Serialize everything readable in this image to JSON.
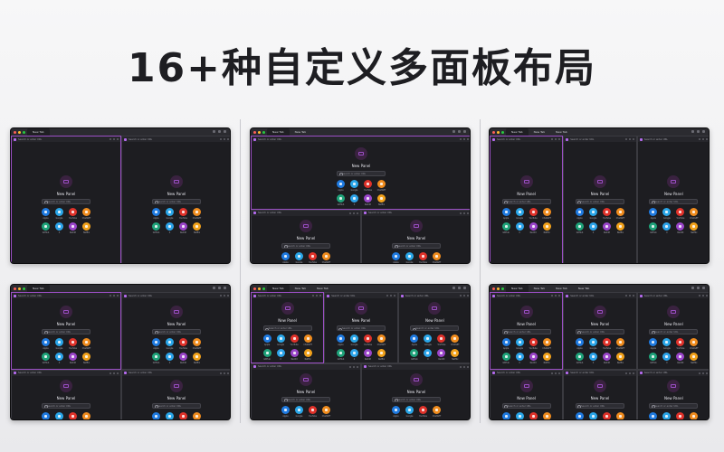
{
  "headline": "16+种自定义多面板布局",
  "browser": {
    "traffic_lights": [
      "#ff5f57",
      "#febc2e",
      "#28c840"
    ],
    "tab_label": "New Tab",
    "panel_url_placeholder": "Search or enter URL"
  },
  "panel": {
    "title": "New Panel",
    "search_placeholder": "Search or enter URL",
    "accent_color": "#9b4fc5",
    "quick_links": [
      {
        "name": "Apple",
        "color": "#1f7ae0"
      },
      {
        "name": "Google",
        "color": "#2aa6e8"
      },
      {
        "name": "YouTube",
        "color": "#e0322a"
      },
      {
        "name": "ChatGPT",
        "color": "#f08c1e"
      },
      {
        "name": "GitHub",
        "color": "#1fa37a"
      },
      {
        "name": "X",
        "color": "#2da4ea"
      },
      {
        "name": "Reddit",
        "color": "#9a45c9"
      },
      {
        "name": "Netflix",
        "color": "#f2a21b"
      }
    ]
  }
}
